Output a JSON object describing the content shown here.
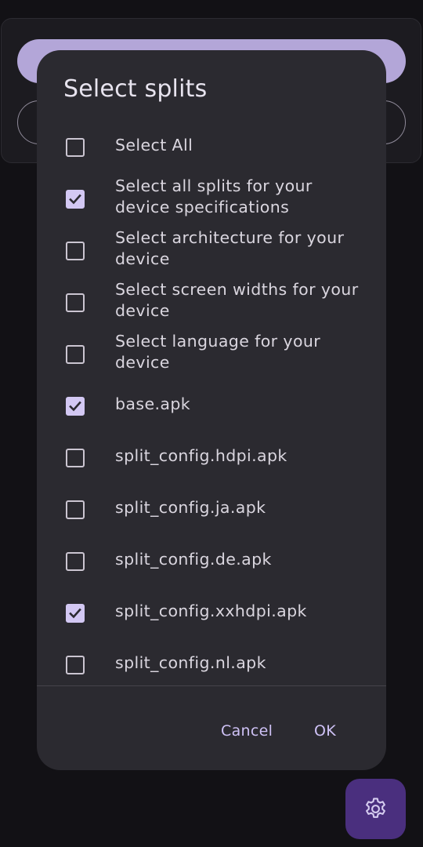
{
  "dialog": {
    "title": "Select splits",
    "items": [
      {
        "label": "Select All",
        "checked": false
      },
      {
        "label": "Select all splits for your device specifications",
        "checked": true
      },
      {
        "label": "Select architecture for your device",
        "checked": false
      },
      {
        "label": "Select screen widths for your device",
        "checked": false
      },
      {
        "label": "Select language for your device",
        "checked": false
      },
      {
        "label": "base.apk",
        "checked": true
      },
      {
        "label": "split_config.hdpi.apk",
        "checked": false
      },
      {
        "label": "split_config.ja.apk",
        "checked": false
      },
      {
        "label": "split_config.de.apk",
        "checked": false
      },
      {
        "label": "split_config.xxhdpi.apk",
        "checked": true
      },
      {
        "label": "split_config.nl.apk",
        "checked": false
      }
    ],
    "cancel_label": "Cancel",
    "ok_label": "OK"
  },
  "fab": {
    "icon": "gear-icon"
  },
  "colors": {
    "dialog_bg": "#2b2a30",
    "accent": "#cfc2f6",
    "checkbox_checked": "#d3c8f3",
    "fab_bg": "#4a2f7e"
  }
}
